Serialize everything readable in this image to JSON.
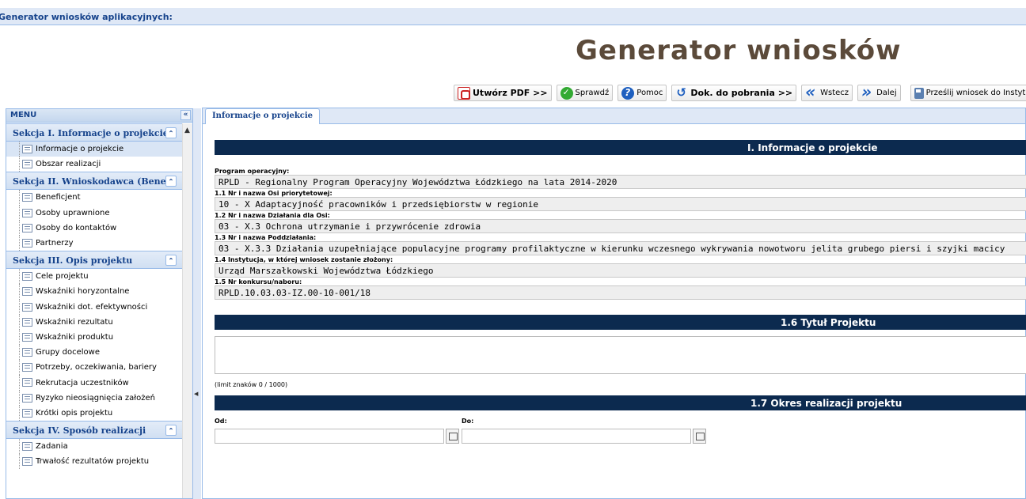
{
  "app_title": "Generator wniosków aplikacyjnych:",
  "big_title": "Generator wniosków",
  "toolbar": {
    "pdf": "Utwórz PDF >>",
    "check": "Sprawdź",
    "help": "Pomoc",
    "docs": "Dok. do pobrania >>",
    "back": "Wstecz",
    "next": "Dalej",
    "send": "Prześlij wniosek do Instytucji"
  },
  "menu": {
    "title": "MENU",
    "sections": [
      {
        "title": "Sekcja I. Informacje o projekcie",
        "items": [
          "Informacje o projekcie",
          "Obszar realizacji"
        ]
      },
      {
        "title": "Sekcja II. Wnioskodawca (Bene...",
        "items": [
          "Beneficjent",
          "Osoby uprawnione",
          "Osoby do kontaktów",
          "Partnerzy"
        ]
      },
      {
        "title": "Sekcja III. Opis projektu",
        "items": [
          "Cele projektu",
          "Wskaźniki horyzontalne",
          "Wskaźniki dot. efektywności",
          "Wskaźniki rezultatu",
          "Wskaźniki produktu",
          "Grupy docelowe",
          "Potrzeby, oczekiwania, bariery",
          "Rekrutacja uczestników",
          "Ryzyko nieosiągnięcia założeń",
          "Krótki opis projektu"
        ]
      },
      {
        "title": "Sekcja IV. Sposób realizacji",
        "items": [
          "Zadania",
          "Trwałość rezultatów projektu"
        ]
      }
    ]
  },
  "tab": "Informacje o projekcie",
  "form": {
    "header1": "I. Informacje o projekcie",
    "program_label": "Program operacyjny:",
    "program_value": "RPLD - Regionalny Program Operacyjny Województwa Łódzkiego na lata 2014-2020",
    "os_label": "1.1 Nr i nazwa Osi priorytetowej:",
    "os_value": "10 - X Adaptacyjność pracowników i przedsiębiorstw w regionie",
    "dzialanie_label": "1.2 Nr i nazwa Działania dla Osi:",
    "dzialanie_value": "03 - X.3 Ochrona utrzymanie i przywrócenie zdrowia",
    "poddzialanie_label": "1.3 Nr i nazwa Poddziałania:",
    "poddzialanie_value": "03 - X.3.3 Działania uzupełniające populacyjne programy profilaktyczne w kierunku wczesnego wykrywania nowotworu jelita grubego piersi i szyjki macicy",
    "instytucja_label": "1.4 Instytucja, w której wniosek zostanie złożony:",
    "instytucja_value": "Urząd Marszałkowski Województwa Łódzkiego",
    "konkurs_label": "1.5 Nr konkursu/naboru:",
    "konkurs_value": "RPLD.10.03.03-IZ.00-10-001/18",
    "header2": "1.6 Tytuł Projektu",
    "limit": "(limit znaków 0 / 1000)",
    "header3": "1.7 Okres realizacji projektu",
    "od_label": "Od:",
    "do_label": "Do:"
  }
}
